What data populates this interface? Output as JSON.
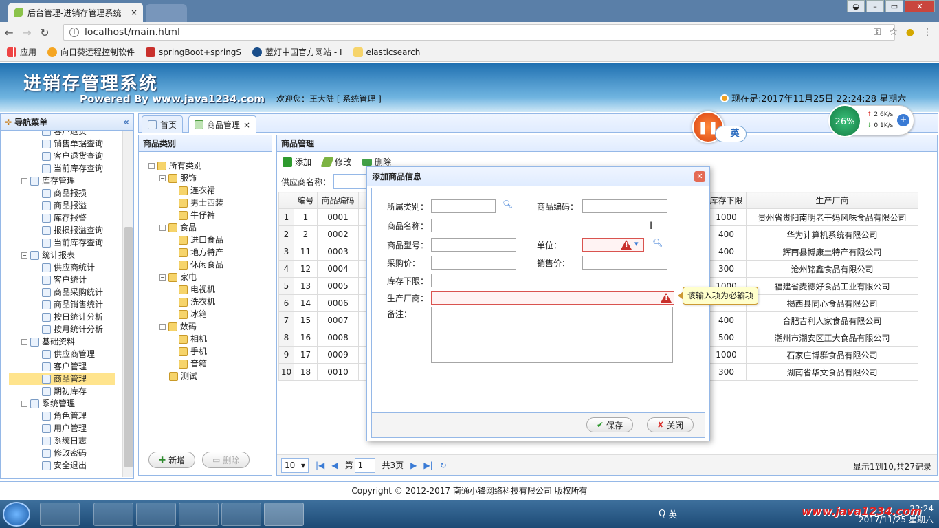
{
  "browser": {
    "tab_title": "后台管理-进销存管理系统",
    "url": "localhost/main.html",
    "bookmarks": [
      "应用",
      "向日葵远程控制软件",
      "springBoot+springS",
      "蓝灯中国官方网站 - I",
      "elasticsearch"
    ]
  },
  "header": {
    "title": "进销存管理系统",
    "powered": "Powered By www.java1234.com",
    "welcome": "欢迎您：王大陆 [ 系统管理 ]",
    "clock": "现在是:2017年11月25日 22:24:28 星期六"
  },
  "nav": {
    "title": "导航菜单",
    "items": [
      {
        "label": "客户退货",
        "level": 2
      },
      {
        "label": "销售单据查询",
        "level": 2
      },
      {
        "label": "客户退货查询",
        "level": 2
      },
      {
        "label": "当前库存查询",
        "level": 2
      },
      {
        "label": "库存管理",
        "level": 1
      },
      {
        "label": "商品报损",
        "level": 2
      },
      {
        "label": "商品报溢",
        "level": 2
      },
      {
        "label": "库存报警",
        "level": 2
      },
      {
        "label": "报损报溢查询",
        "level": 2
      },
      {
        "label": "当前库存查询",
        "level": 2
      },
      {
        "label": "统计报表",
        "level": 1
      },
      {
        "label": "供应商统计",
        "level": 2
      },
      {
        "label": "客户统计",
        "level": 2
      },
      {
        "label": "商品采购统计",
        "level": 2
      },
      {
        "label": "商品销售统计",
        "level": 2
      },
      {
        "label": "按日统计分析",
        "level": 2
      },
      {
        "label": "按月统计分析",
        "level": 2
      },
      {
        "label": "基础资料",
        "level": 1
      },
      {
        "label": "供应商管理",
        "level": 2
      },
      {
        "label": "客户管理",
        "level": 2
      },
      {
        "label": "商品管理",
        "level": 2,
        "selected": true
      },
      {
        "label": "期初库存",
        "level": 2
      },
      {
        "label": "系统管理",
        "level": 1
      },
      {
        "label": "角色管理",
        "level": 2
      },
      {
        "label": "用户管理",
        "level": 2
      },
      {
        "label": "系统日志",
        "level": 2
      },
      {
        "label": "修改密码",
        "level": 2
      },
      {
        "label": "安全退出",
        "level": 2
      }
    ]
  },
  "tabs": [
    {
      "label": "首页"
    },
    {
      "label": "商品管理"
    }
  ],
  "category": {
    "title": "商品类别",
    "tree": [
      {
        "label": "所有类别",
        "level": 0
      },
      {
        "label": "服饰",
        "level": 1
      },
      {
        "label": "连衣裙",
        "level": 2
      },
      {
        "label": "男士西装",
        "level": 2
      },
      {
        "label": "牛仔裤",
        "level": 2
      },
      {
        "label": "食品",
        "level": 1
      },
      {
        "label": "进口食品",
        "level": 2
      },
      {
        "label": "地方特产",
        "level": 2
      },
      {
        "label": "休闲食品",
        "level": 2
      },
      {
        "label": "家电",
        "level": 1
      },
      {
        "label": "电视机",
        "level": 2
      },
      {
        "label": "洗衣机",
        "level": 2
      },
      {
        "label": "冰箱",
        "level": 2
      },
      {
        "label": "数码",
        "level": 1
      },
      {
        "label": "相机",
        "level": 2
      },
      {
        "label": "手机",
        "level": 2
      },
      {
        "label": "音箱",
        "level": 2
      },
      {
        "label": "测试",
        "level": 1
      }
    ],
    "add_label": "新增",
    "delete_label": "删除"
  },
  "goods": {
    "title": "商品管理",
    "add_label": "添加",
    "edit_label": "修改",
    "delete_label": "删除",
    "search_label": "供应商名称：",
    "columns": [
      "编号",
      "商品编码",
      "库存下限",
      "生产厂商"
    ],
    "rows": [
      {
        "n": "1",
        "id": "1",
        "code": "0001",
        "min": "1000",
        "maker": "贵州省贵阳南明老干妈风味食品有限公司"
      },
      {
        "n": "2",
        "id": "2",
        "code": "0002",
        "min": "400",
        "maker": "华为计算机系统有限公司"
      },
      {
        "n": "3",
        "id": "11",
        "code": "0003",
        "min": "400",
        "maker": "辉南县博康土特产有限公司"
      },
      {
        "n": "4",
        "id": "12",
        "code": "0004",
        "min": "300",
        "maker": "沧州铭鑫食品有限公司"
      },
      {
        "n": "5",
        "id": "13",
        "code": "0005",
        "min": "1000",
        "maker": "福建省麦德好食品工业有限公司"
      },
      {
        "n": "6",
        "id": "14",
        "code": "0006",
        "min": "",
        "maker": "揭西县同心食品有限公司"
      },
      {
        "n": "7",
        "id": "15",
        "code": "0007",
        "min": "400",
        "maker": "合肥吉利人家食品有限公司"
      },
      {
        "n": "8",
        "id": "16",
        "code": "0008",
        "min": "500",
        "maker": "潮州市潮安区正大食品有限公司"
      },
      {
        "n": "9",
        "id": "17",
        "code": "0009",
        "min": "1000",
        "maker": "石家庄博群食品有限公司"
      },
      {
        "n": "10",
        "id": "18",
        "code": "0010",
        "min": "300",
        "maker": "湖南省华文食品有限公司"
      }
    ],
    "pager": {
      "page_size": "10",
      "page_prefix": "第",
      "page": "1",
      "page_suffix": "共3页",
      "info": "显示1到10,共27记录"
    }
  },
  "dialog": {
    "title": "添加商品信息",
    "category_label": "所属类别：",
    "code_label": "商品编码：",
    "name_label": "商品名称：",
    "model_label": "商品型号：",
    "unit_label": "单位：",
    "purchase_label": "采购价：",
    "sale_label": "销售价：",
    "min_label": "库存下限：",
    "maker_label": "生产厂商：",
    "remark_label": "备注：",
    "save_label": "保存",
    "close_label": "关闭",
    "tooltip": "该输入项为必输项"
  },
  "overlay": {
    "ime": "英",
    "cpu": "26%",
    "up": "2.6K/s",
    "down": "0.1K/s"
  },
  "footer": {
    "copyright": "Copyright © 2012-2017 南通小锋网络科技有限公司 版权所有"
  },
  "taskbar": {
    "ime": "英",
    "time": "22:24",
    "date": "2017/11/25 星期六",
    "watermark": "www.java1234.com"
  },
  "colors": {
    "accent": "#95b8e7",
    "selected": "#ffe48d",
    "error": "#c9302c"
  }
}
